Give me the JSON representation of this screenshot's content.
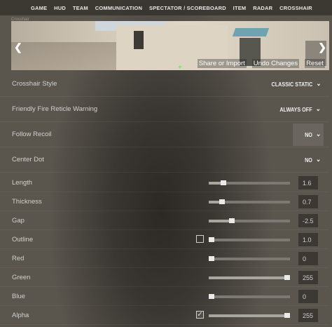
{
  "nav": {
    "tabs": [
      "GAME",
      "HUD",
      "TEAM",
      "COMMUNICATION",
      "SPECTATOR / SCOREBOARD",
      "ITEM",
      "RADAR",
      "CROSSHAIR"
    ]
  },
  "preview": {
    "cut_label": "Crosshair",
    "share_label": "Share or Import",
    "undo_label": "Undo Changes",
    "reset_label": "Reset",
    "crosshair_color": "#33ff33"
  },
  "settings": [
    {
      "label": "Crosshair Style",
      "value": "CLASSIC STATIC"
    },
    {
      "label": "Friendly Fire Reticle Warning",
      "value": "ALWAYS OFF"
    },
    {
      "label": "Follow Recoil",
      "value": "NO"
    },
    {
      "label": "Center Dot",
      "value": "NO"
    }
  ],
  "sliders": [
    {
      "label": "Length",
      "value": "1.6",
      "fraction": 0.16
    },
    {
      "label": "Thickness",
      "value": "0.7",
      "fraction": 0.14
    },
    {
      "label": "Gap",
      "value": "-2.5",
      "fraction": 0.27
    },
    {
      "label": "Outline",
      "value": "1.0",
      "fraction": 0.0,
      "checkbox": false
    },
    {
      "label": "Red",
      "value": "0",
      "fraction": 0.0
    },
    {
      "label": "Green",
      "value": "255",
      "fraction": 1.0
    },
    {
      "label": "Blue",
      "value": "0",
      "fraction": 0.0
    },
    {
      "label": "Alpha",
      "value": "255",
      "fraction": 1.0,
      "checkbox": true
    }
  ],
  "icons": {
    "prev": "chevron-left-icon",
    "next": "chevron-right-icon",
    "dropdown": "chevron-down-icon",
    "checked": "checkmark-icon"
  }
}
